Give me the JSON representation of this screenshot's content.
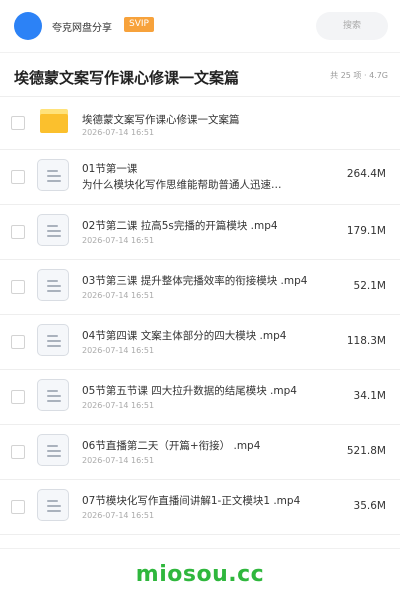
{
  "header": {
    "app_name": "夸克网盘分享",
    "badge": "SVIP",
    "search_placeholder": "搜索"
  },
  "folder_title": "埃德蒙文案写作课心修课一文案篇",
  "summary": "共 25 项 · 4.7G",
  "items": [
    {
      "type": "folder",
      "name": "埃德蒙文案写作课心修课一文案篇",
      "date": "2026-07-14 16:51",
      "size": ""
    },
    {
      "type": "file",
      "name": "01节第一课",
      "subtitle": "为什么模块化写作思维能帮助普通人迅速…",
      "date": "",
      "size": "264.4M"
    },
    {
      "type": "file",
      "name": "02节第二课 拉高5s完播的开篇模块 .mp4",
      "date": "2026-07-14 16:51",
      "size": "179.1M"
    },
    {
      "type": "file",
      "name": "03节第三课 提升整体完播效率的衔接模块 .mp4",
      "date": "2026-07-14 16:51",
      "size": "52.1M"
    },
    {
      "type": "file",
      "name": "04节第四课 文案主体部分的四大模块 .mp4",
      "date": "2026-07-14 16:51",
      "size": "118.3M"
    },
    {
      "type": "file",
      "name": "05节第五节课 四大拉升数据的结尾模块 .mp4",
      "date": "2026-07-14 16:51",
      "size": "34.1M"
    },
    {
      "type": "file",
      "name": "06节直播第二天（开篇+衔接） .mp4",
      "date": "2026-07-14 16:51",
      "size": "521.8M"
    },
    {
      "type": "file",
      "name": "07节模块化写作直播间讲解1-正文模块1 .mp4",
      "date": "2026-07-14 16:51",
      "size": "35.6M"
    }
  ],
  "watermark": "miosou.cc",
  "colors": {
    "accent_blue": "#2c82f6",
    "svip_orange": "#f7a23b",
    "folder_yellow": "#fbc02d",
    "watermark_green": "#2fb73d"
  }
}
